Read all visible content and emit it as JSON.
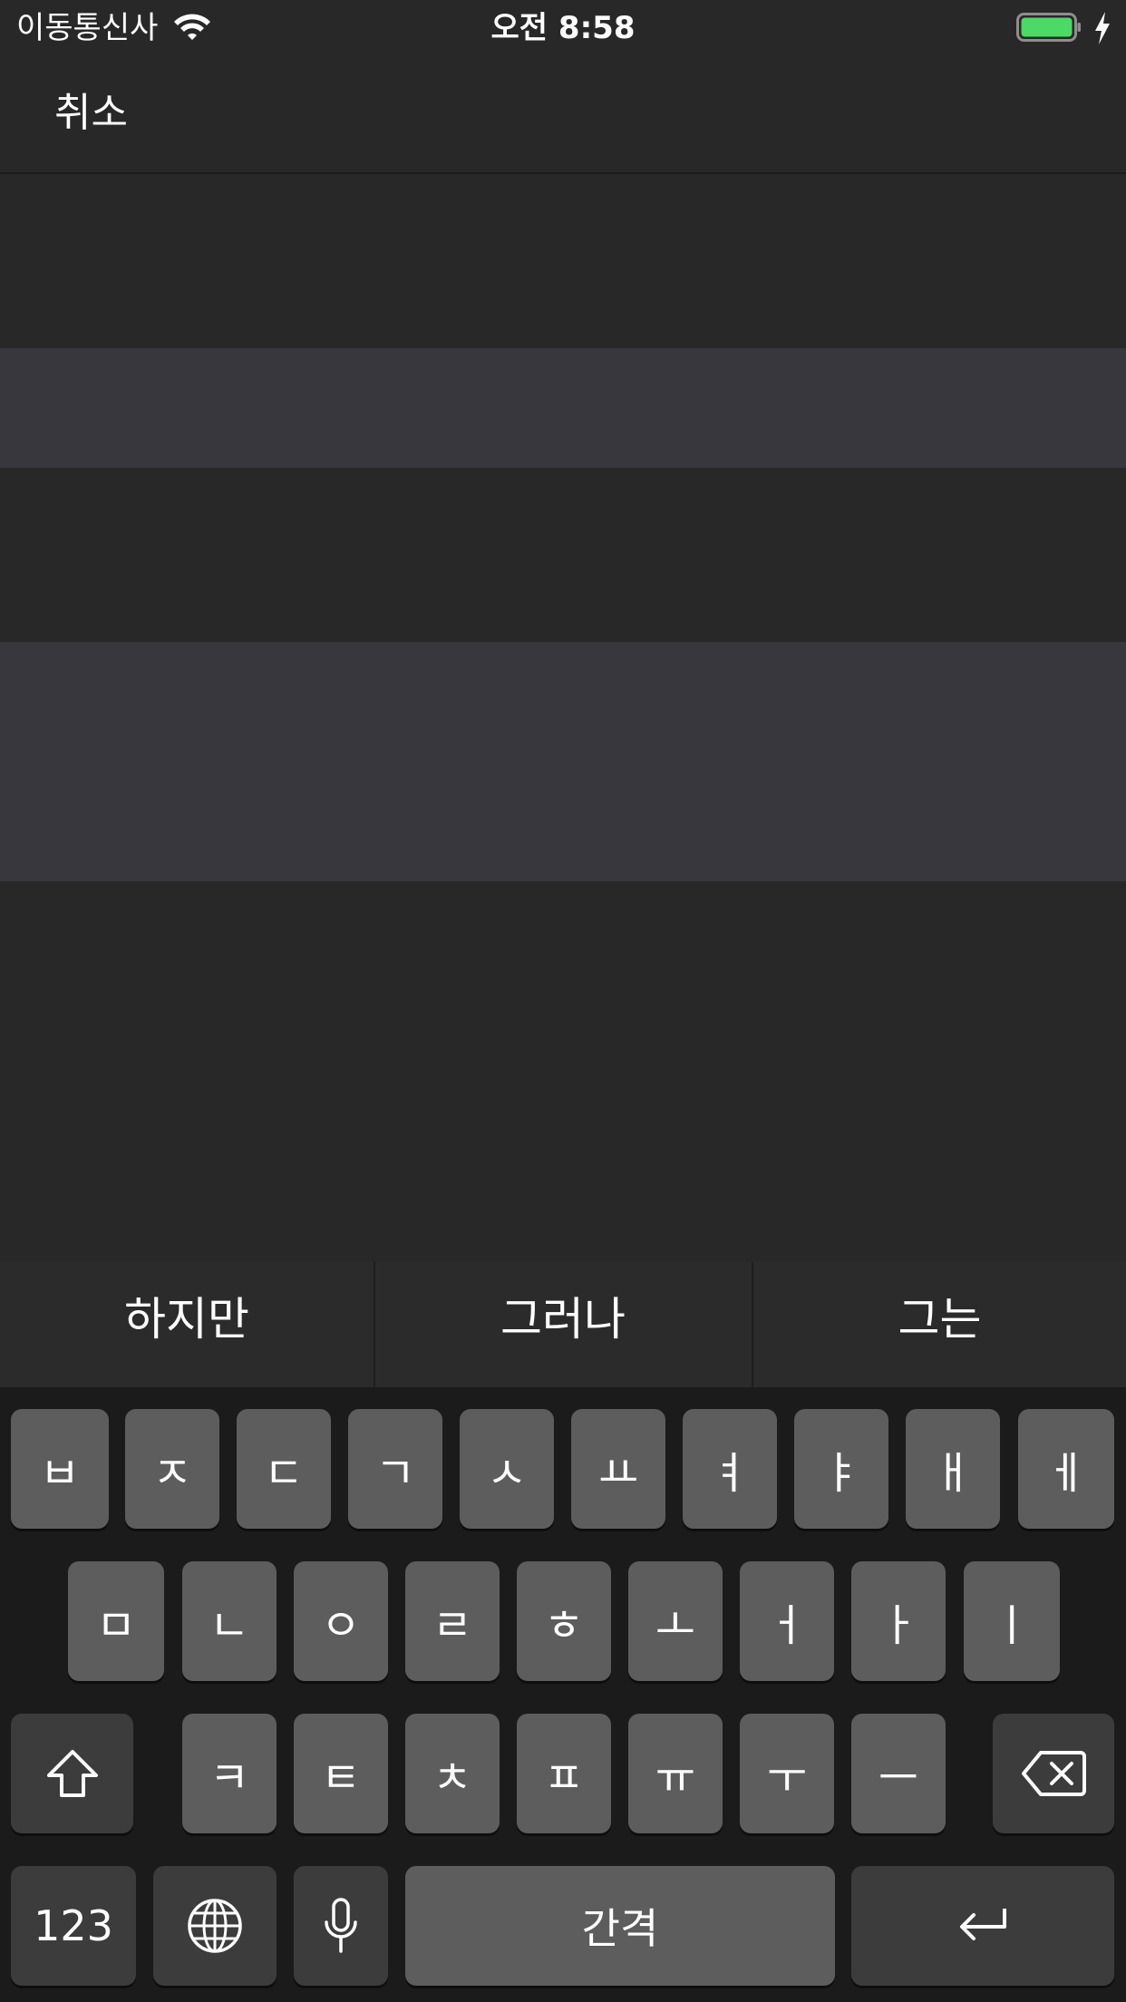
{
  "status_bar": {
    "carrier": "이동통신사",
    "time": "오전 8:58",
    "battery_color": "#4cd964",
    "wifi_icon": "wifi-icon",
    "charging_icon": "bolt-icon"
  },
  "nav": {
    "cancel_label": "취소"
  },
  "suggestions": [
    "하지만",
    "그러나",
    "그는"
  ],
  "keyboard": {
    "row1": [
      "ㅂ",
      "ㅈ",
      "ㄷ",
      "ㄱ",
      "ㅅ",
      "ㅛ",
      "ㅕ",
      "ㅑ",
      "ㅐ",
      "ㅔ"
    ],
    "row2": [
      "ㅁ",
      "ㄴ",
      "ㅇ",
      "ㄹ",
      "ㅎ",
      "ㅗ",
      "ㅓ",
      "ㅏ",
      "ㅣ"
    ],
    "row3": [
      "ㅋ",
      "ㅌ",
      "ㅊ",
      "ㅍ",
      "ㅠ",
      "ㅜ",
      "ㅡ"
    ],
    "numbers_label": "123",
    "space_label": "간격",
    "icons": [
      "shift-icon",
      "delete-icon",
      "globe-icon",
      "microphone-icon",
      "return-icon"
    ]
  }
}
